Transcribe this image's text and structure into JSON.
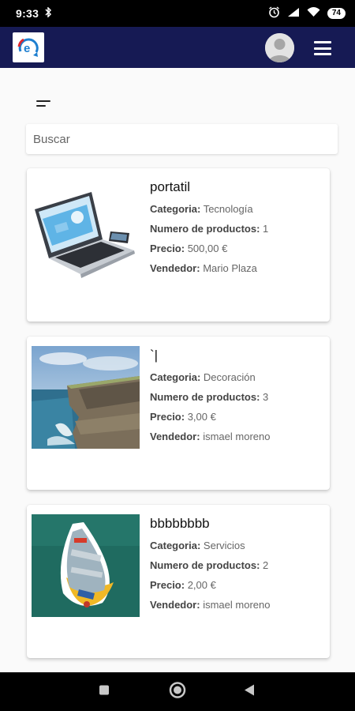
{
  "status_bar": {
    "time": "9:33",
    "battery": "74"
  },
  "search": {
    "placeholder": "Buscar"
  },
  "products": [
    {
      "title": "portatil",
      "category_label": "Categoria:",
      "category": "Tecnología",
      "quantity_label": "Numero de productos:",
      "quantity": "1",
      "price_label": "Precio:",
      "price": "500,00 €",
      "seller_label": "Vendedor:",
      "seller": "Mario Plaza",
      "image": "laptop"
    },
    {
      "title": "`|",
      "category_label": "Categoria:",
      "category": "Decoración",
      "quantity_label": "Numero de productos:",
      "quantity": "3",
      "price_label": "Precio:",
      "price": "3,00 €",
      "seller_label": "Vendedor:",
      "seller": "ismael moreno",
      "image": "cliff"
    },
    {
      "title": "bbbbbbbb",
      "category_label": "Categoria:",
      "category": "Servicios",
      "quantity_label": "Numero de productos:",
      "quantity": "2",
      "price_label": "Precio:",
      "price": "2,00 €",
      "seller_label": "Vendedor:",
      "seller": "ismael moreno",
      "image": "boat"
    }
  ],
  "icons": {
    "logo": "app-logo",
    "avatar": "user-avatar-icon",
    "menu": "hamburger-menu-icon",
    "sort": "sort-icon",
    "nav_home": "home-circle-icon",
    "nav_back": "back-triangle-icon",
    "nav_recents": "recents-square-icon"
  },
  "colors": {
    "app_bar": "#161a54",
    "background": "#fafafa",
    "card": "#ffffff"
  }
}
